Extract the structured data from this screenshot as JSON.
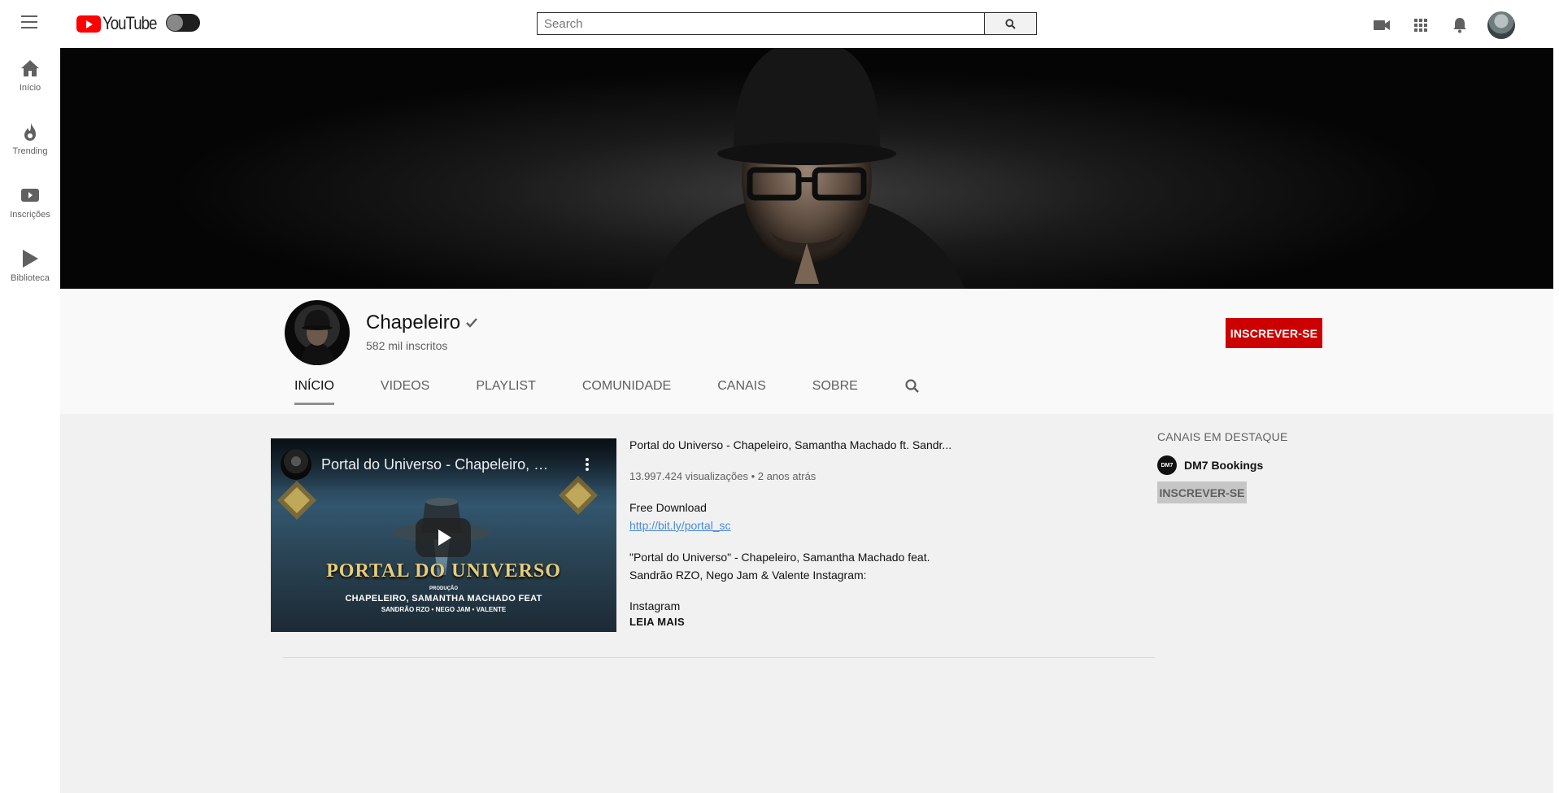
{
  "app": {
    "logo_text": "YouTube"
  },
  "search": {
    "placeholder": "Search"
  },
  "sidebar": {
    "items": [
      {
        "label": "Início",
        "icon": "home-icon"
      },
      {
        "label": "Trending",
        "icon": "flame-icon"
      },
      {
        "label": "Inscrições",
        "icon": "subscriptions-icon"
      },
      {
        "label": "Biblioteca",
        "icon": "library-play-icon"
      }
    ]
  },
  "header_icons": [
    "video-camera-icon",
    "apps-grid-icon",
    "bell-icon",
    "avatar"
  ],
  "channel": {
    "name": "Chapeleiro",
    "verified": true,
    "subscribers": "582 mil inscritos",
    "subscribe_label": "INSCREVER-SE",
    "tabs": [
      "INÍCIO",
      "VIDEOS",
      "PLAYLIST",
      "COMUNIDADE",
      "CANAIS",
      "SOBRE"
    ],
    "active_tab": 0
  },
  "featured_video": {
    "thumb_title": "Portal do Universo - Chapeleiro, Sa...",
    "thumb_logo": "PORTAL DO UNIVERSO",
    "thumb_prod": "PRODUÇÃO",
    "thumb_credits": "CHAPELEIRO, SAMANTHA MACHADO FEAT",
    "thumb_credits_2": "SANDRÃO RZO • NEGO JAM • VALENTE",
    "title": "Portal do Universo - Chapeleiro, Samantha Machado ft. Sandr...",
    "meta": "13.997.424 visualizações • 2 anos atrás",
    "desc_line1": "Free Download",
    "desc_link": "http://bit.ly/portal_sc",
    "desc_para_1": "\"Portal do Universo\" - Chapeleiro, Samantha Machado feat.",
    "desc_para_2": "Sandrão RZO, Nego Jam & Valente Instagram:",
    "desc_last": "Instagram",
    "read_more": "LEIA MAIS"
  },
  "featured_channels": {
    "title": "CANAIS EM DESTAQUE",
    "items": [
      {
        "name": "DM7 Bookings",
        "logo_text": "DM7",
        "subscribe_label": "INSCREVER-SE"
      }
    ]
  },
  "colors": {
    "subscribe_red": "#cc0000",
    "link_blue": "#4b8bd9",
    "page_bg": "#f1f1f1",
    "header_bg": "#f9f9f9"
  }
}
